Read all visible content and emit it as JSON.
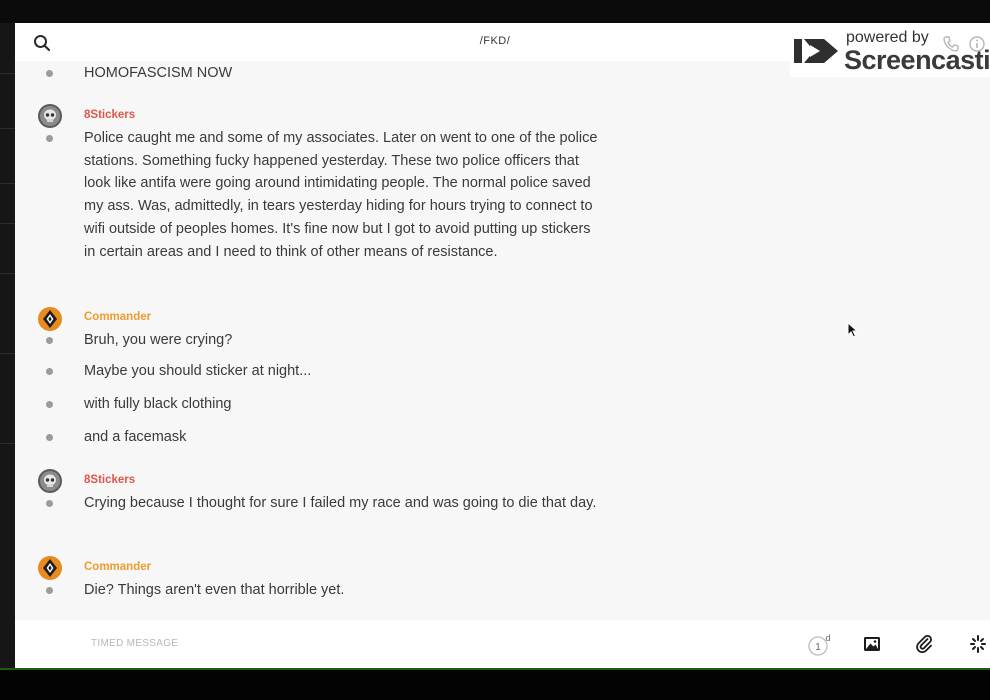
{
  "header": {
    "channel_title": "/FKD/"
  },
  "watermark": {
    "powered_by": "powered by",
    "brand": "Screencastify"
  },
  "messages": [
    {
      "type": "line",
      "text": "HOMOFASCISM NOW"
    },
    {
      "type": "author",
      "name": "8Stickers",
      "avatar": "skull-avatar"
    },
    {
      "type": "line",
      "text": "Police caught me and some of my associates. Later on went to one of the police stations. Something fucky happened yesterday. These two police officers that look like antifa were going around intimidating people. The normal police saved my ass. Was, admittedly, in tears yesterday hiding for hours trying to connect to wifi outside of peoples homes. It's fine now but I got to avoid putting up stickers in certain areas and I need to think of other means of resistance."
    },
    {
      "type": "author",
      "name": "Commander",
      "avatar": "orange-diamond-avatar"
    },
    {
      "type": "line",
      "text": "Bruh, you were crying?"
    },
    {
      "type": "line",
      "text": "Maybe you should sticker at night..."
    },
    {
      "type": "line",
      "text": "with fully black clothing"
    },
    {
      "type": "line",
      "text": "and a facemask"
    },
    {
      "type": "author",
      "name": "8Stickers",
      "avatar": "skull-avatar"
    },
    {
      "type": "line",
      "text": "Crying because I thought for sure I failed my race and was going to die that day."
    },
    {
      "type": "author",
      "name": "Commander",
      "avatar": "orange-diamond-avatar"
    },
    {
      "type": "line",
      "text": "Die? Things aren't even that horrible yet."
    }
  ],
  "composer": {
    "timed_placeholder": "TIMED MESSAGE",
    "timer_value": "1",
    "timer_unit": "d"
  },
  "colors": {
    "author_8stickers": "#e0564c",
    "author_commander": "#ef9b2e",
    "background": "#f7f7f7"
  }
}
